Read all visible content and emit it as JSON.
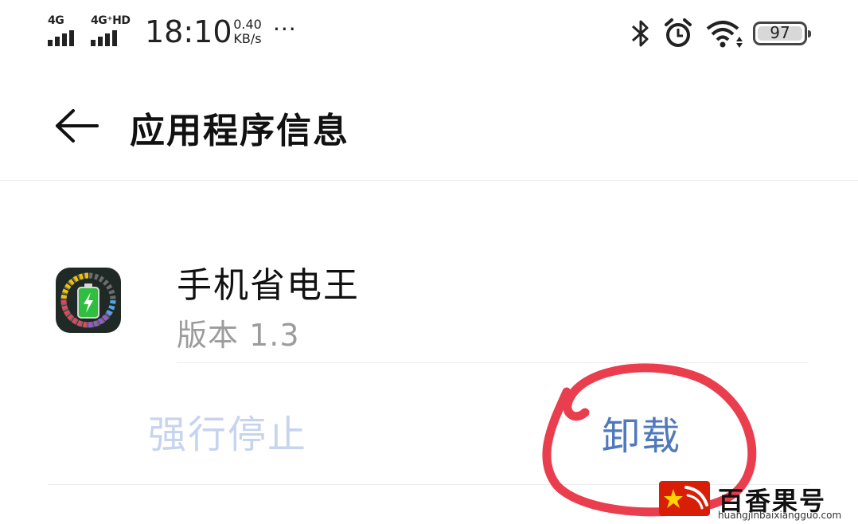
{
  "status_bar": {
    "network_1": "4G",
    "network_2": "4G⁺HD",
    "time": "18:10",
    "speed_value": "0.40",
    "speed_unit": "KB/s",
    "more": "···",
    "battery_level": "97",
    "icons": [
      "bluetooth-icon",
      "alarm-icon",
      "wifi-icon"
    ]
  },
  "header": {
    "title": "应用程序信息"
  },
  "app": {
    "name": "手机省电王",
    "version": "版本 1.3",
    "icon": "battery-app-icon"
  },
  "actions": {
    "force_stop": "强行停止",
    "uninstall": "卸载"
  },
  "annotation": {
    "color": "#e8283b"
  },
  "watermark": {
    "title": "百香果号",
    "url": "huangjinbaixiangguo.com"
  },
  "colors": {
    "accent": "#4f78bd",
    "disabled": "#c7d4ee",
    "secondary_text": "#9c9c9c"
  }
}
